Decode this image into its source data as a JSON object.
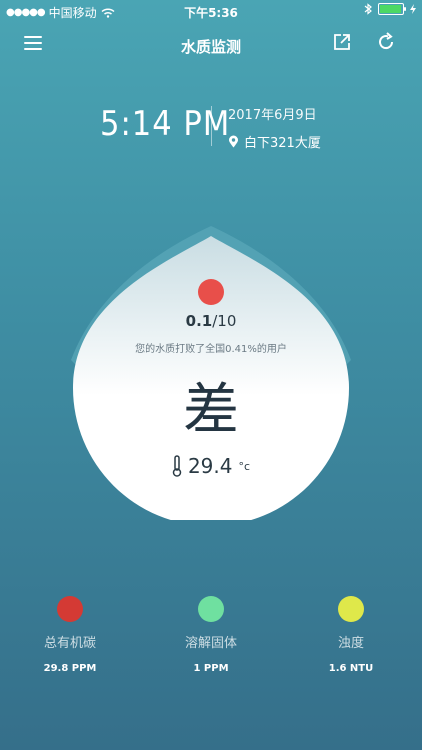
{
  "status_bar": {
    "carrier": "中国移动",
    "time": "下午5:36"
  },
  "nav": {
    "title": "水质监测"
  },
  "header": {
    "time": "5:14 PM",
    "date": "2017年6月9日",
    "location": "白下321大厦"
  },
  "card": {
    "score_value": "0.1",
    "score_total": "/10",
    "beat_text": "您的水质打败了全国0.41%的用户",
    "grade": "差",
    "temperature": "29.4",
    "temp_unit": "°c"
  },
  "metrics": [
    {
      "name": "总有机碳",
      "value": "29.8 PPM",
      "color": "#d43a34"
    },
    {
      "name": "溶解固体",
      "value": "1 PPM",
      "color": "#6fe0a0"
    },
    {
      "name": "浊度",
      "value": "1.6 NTU",
      "color": "#dfe84a"
    }
  ],
  "colors": {
    "status_red": "#e84f4a",
    "battery_green": "#4cd964"
  },
  "icons": [
    "menu-icon",
    "share-icon",
    "refresh-icon",
    "location-pin-icon",
    "thermometer-icon",
    "wifi-icon",
    "bluetooth-icon",
    "battery-icon"
  ]
}
